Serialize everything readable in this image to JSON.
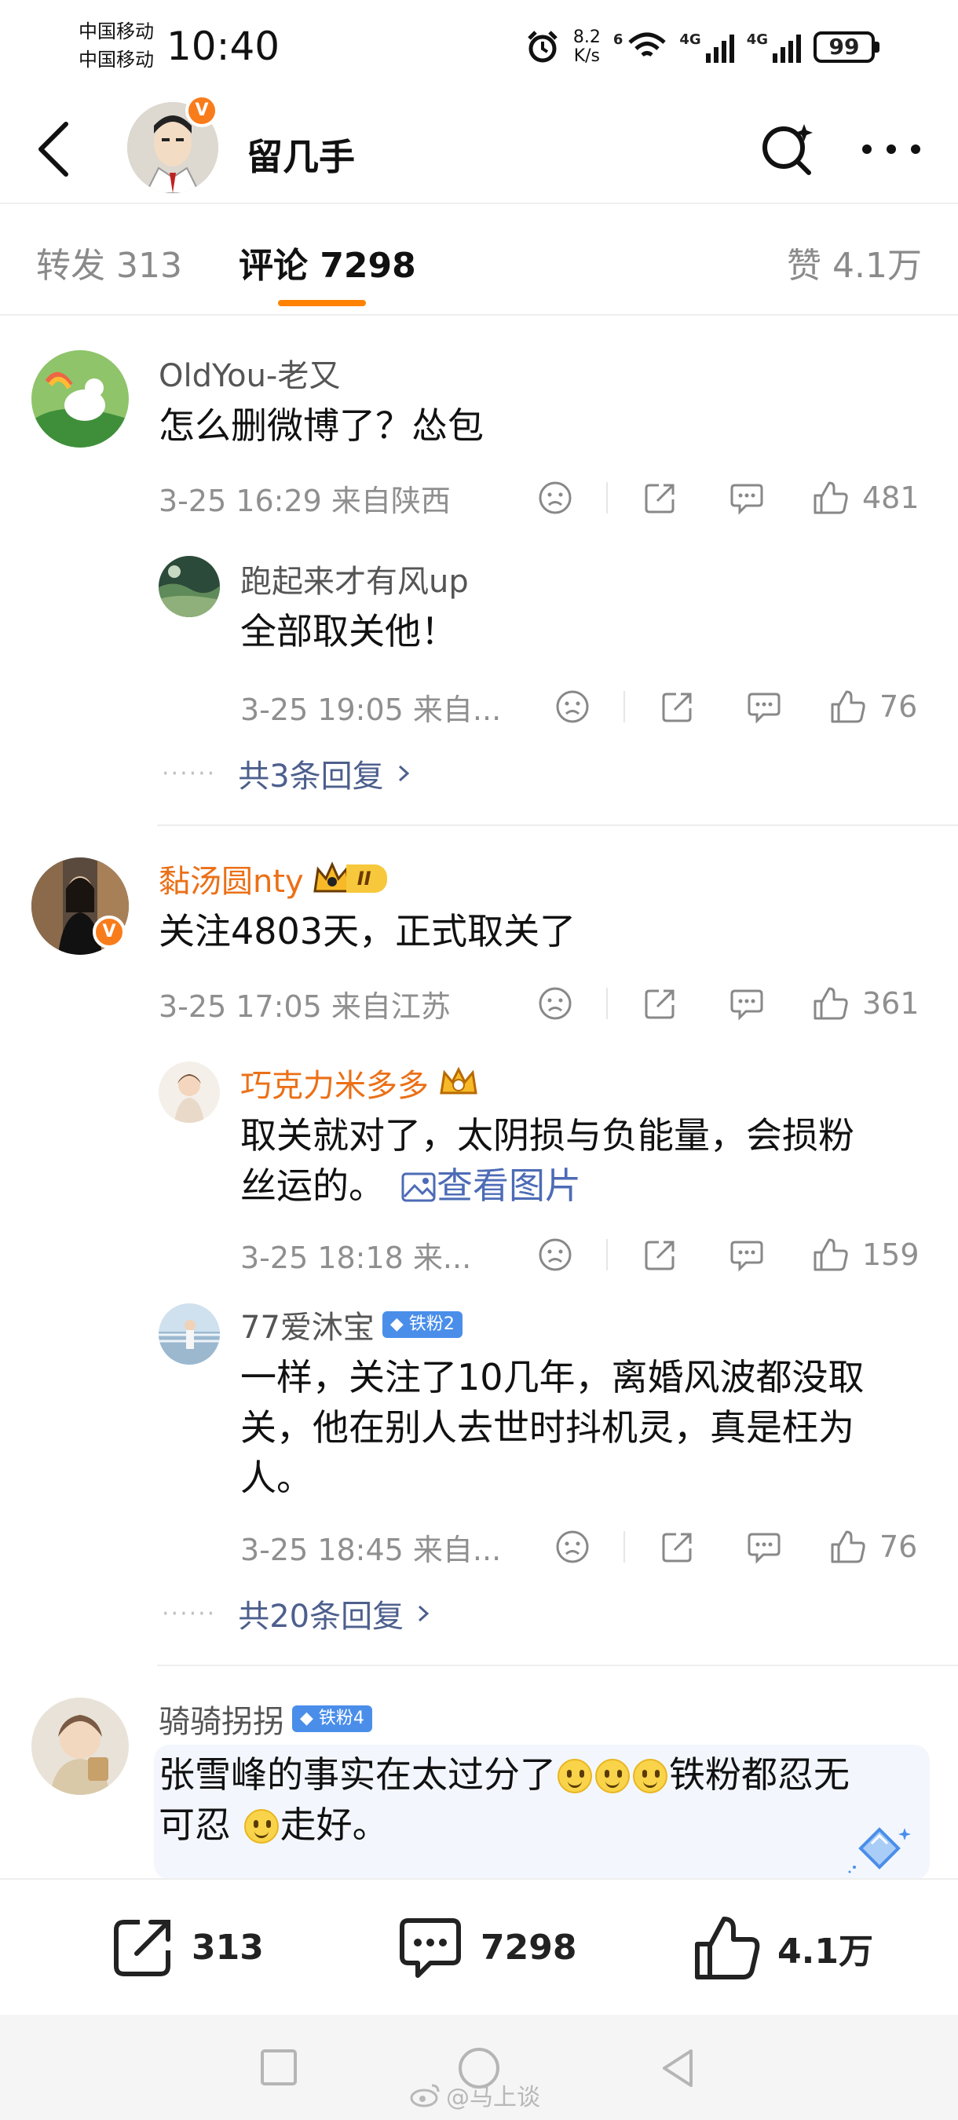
{
  "status_bar": {
    "carrier1": "中国移动",
    "carrier2": "中国移动",
    "time": "10:40",
    "speed_value": "8.2",
    "speed_unit": "K/s",
    "wifi_label": "6",
    "signal1_label": "4G",
    "signal2_label": "4G",
    "battery": "99"
  },
  "header": {
    "title": "留几手",
    "verified_badge": "V"
  },
  "tabs": [
    {
      "label": "转发 313"
    },
    {
      "label": "评论 7298"
    },
    {
      "label": "赞 4.1万"
    }
  ],
  "comments": [
    {
      "user": "OldYou-老又",
      "text": "怎么删微博了？怂包",
      "meta": "3-25 16:29  来自陕西",
      "likes": "481",
      "replies": [
        {
          "user": "跑起来才有风up",
          "text": "全部取关他！",
          "meta": "3-25 19:05  来自...",
          "likes": "76"
        }
      ],
      "more_replies": "共3条回复"
    },
    {
      "user": "黏汤圆nty",
      "level": "II",
      "verified_badge": "V",
      "text": "关注4803天，正式取关了",
      "meta": "3-25 17:05  来自江苏",
      "likes": "361",
      "replies": [
        {
          "user": "巧克力米多多",
          "text_line1": "取关就对了，太阴损与负能量，会损粉",
          "text_line2": "丝运的。",
          "view_pic": "查看图片",
          "meta": "3-25 18:18  来...",
          "likes": "159"
        },
        {
          "user": "77爱沐宝",
          "fan_badge": "铁粉2",
          "text_line1": "一样，关注了10几年，离婚风波都没取",
          "text_line2": "关，他在别人去世时抖机灵，真是枉为",
          "text_line3": "人。",
          "meta": "3-25 18:45  来自...",
          "likes": "76"
        }
      ],
      "more_replies": "共20条回复"
    },
    {
      "user": "骑骑拐拐",
      "fan_badge": "铁粉4",
      "text_line1_a": "张雪峰的事实在太过分了",
      "text_line1_b": "铁粉都忍无",
      "text_line2_a": "可忍",
      "text_line2_b": "走好。"
    }
  ],
  "bottom_bar": {
    "repost_count": "313",
    "comment_count": "7298",
    "like_count": "4.1万"
  },
  "watermark": "@马上谈",
  "colors": {
    "accent_orange": "#ff8200",
    "username_orange": "#eb7017",
    "link_blue": "#4d6bb6",
    "fan_badge_blue": "#4a8eea"
  }
}
